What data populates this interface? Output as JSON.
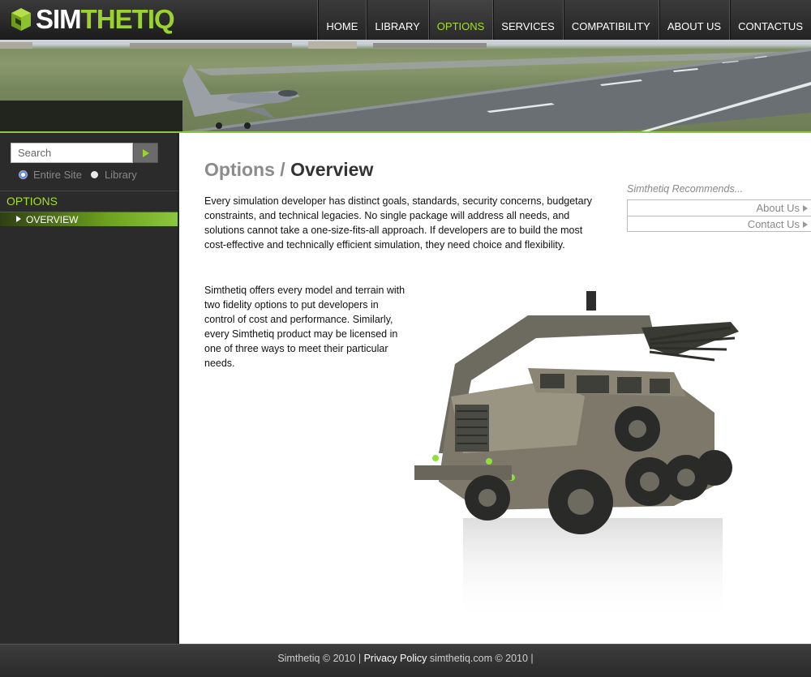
{
  "logo": {
    "part1": "SIM",
    "part2": "THETIQ"
  },
  "nav": [
    {
      "label": "HOME"
    },
    {
      "label": "LIBRARY"
    },
    {
      "label": "OPTIONS"
    },
    {
      "label": "SERVICES"
    },
    {
      "label": "COMPATIBILITY"
    },
    {
      "label": "ABOUT US"
    },
    {
      "label": "CONTACTUS"
    }
  ],
  "search": {
    "placeholder": "Search",
    "scope_options": [
      "Entire Site",
      "Library"
    ],
    "selected_scope": "Entire Site"
  },
  "sidebar": {
    "heading": "OPTIONS",
    "items": [
      {
        "label": "OVERVIEW"
      }
    ]
  },
  "main": {
    "title_crumb": "Options /",
    "title_current": "Overview",
    "paragraph1": "Every simulation developer has distinct goals, standards, security concerns, budgetary constraints, and technical legacies. No single package will address all needs, and solutions cannot take a one-size-fits-all approach. If developers are to build the most cost-effective and technically efficient simulation, they need choice and flexibility.",
    "paragraph2": "Simthetiq offers every model and terrain with two fidelity options to put developers in control of cost and performance. Similarly, every Simthetiq product may be licensed in one of three ways to meet their particular needs."
  },
  "recommends": {
    "title": "Simthetiq Recommends...",
    "links": [
      {
        "label": "About Us"
      },
      {
        "label": "Contact Us"
      }
    ]
  },
  "footer": {
    "copyright": "Simthetiq © 2010 |",
    "privacy": "Privacy Policy",
    "site": "simthetiq.com © 2010 |"
  },
  "colors": {
    "accent": "#9bd230",
    "nav_active": "#a6e022",
    "sidebar_bg": "#2b2b2b"
  }
}
